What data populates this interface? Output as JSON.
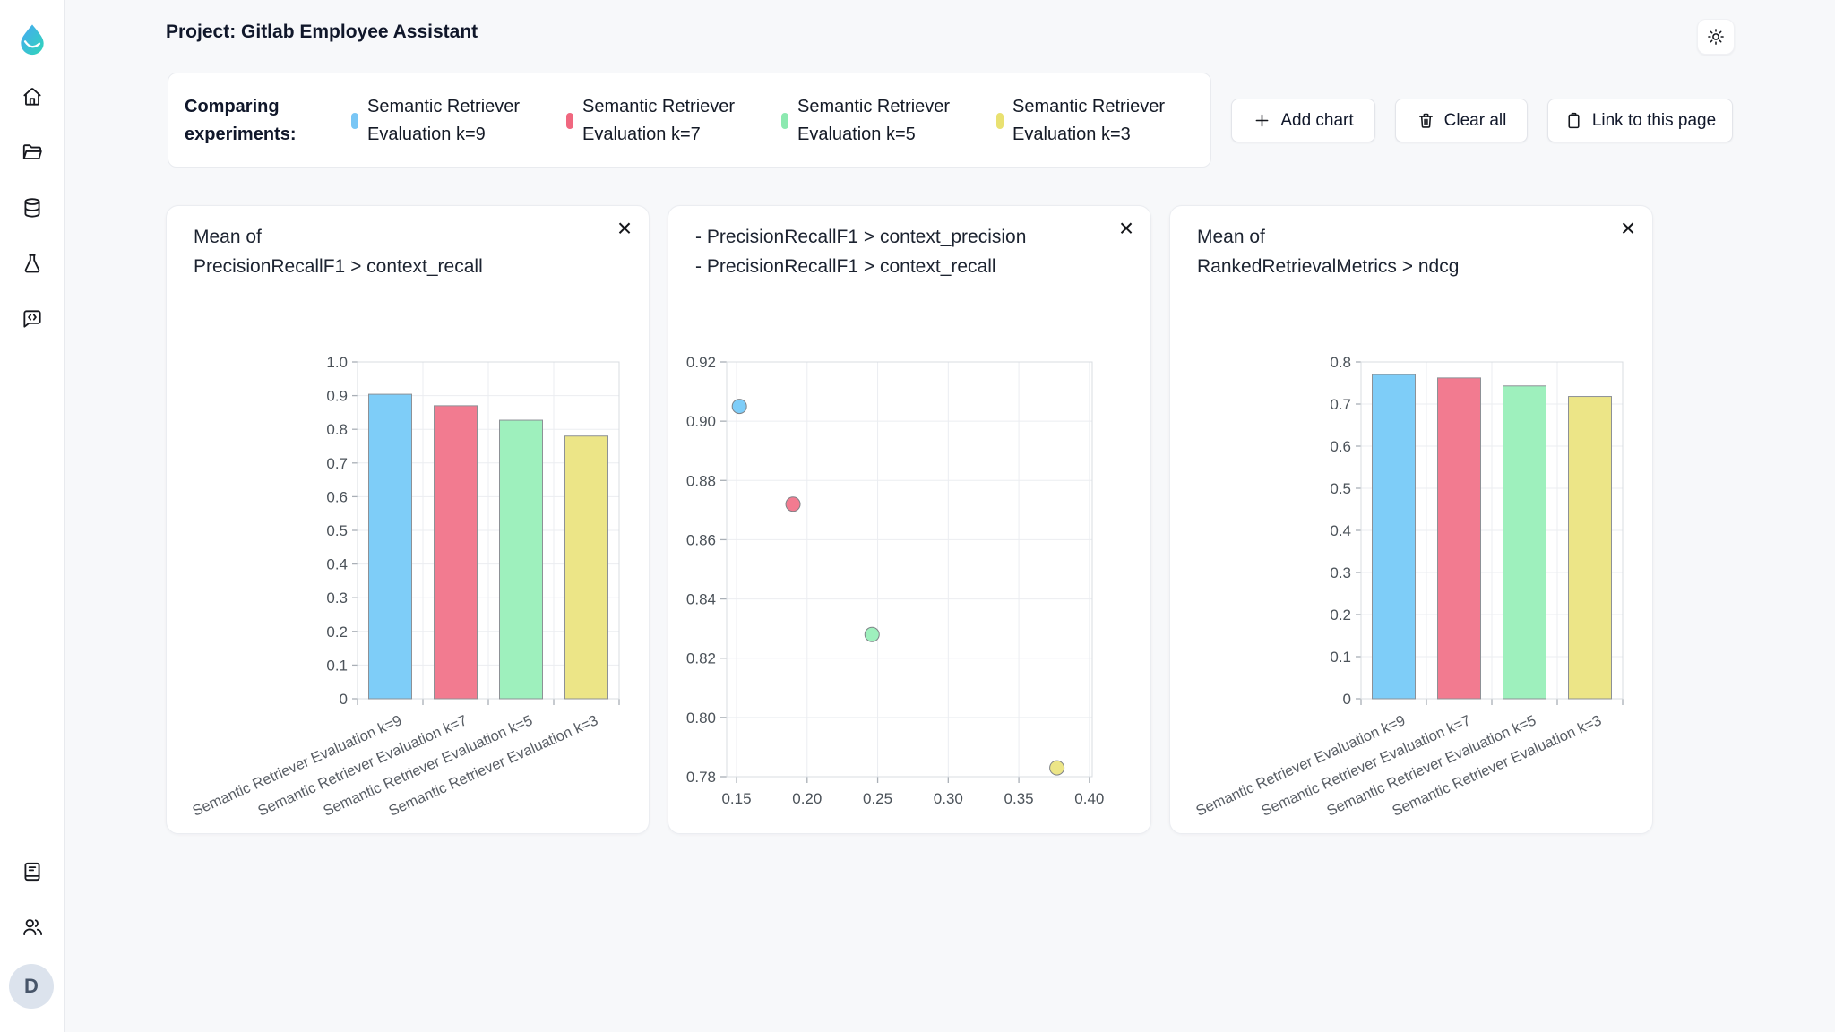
{
  "header": {
    "title": "Project: Gitlab Employee Assistant",
    "theme_toggle_icon": "sun-icon"
  },
  "sidebar": {
    "logo_icon": "app-logo-droplet",
    "items": [
      "home-icon",
      "folder-icon",
      "database-icon",
      "flask-icon",
      "chat-code-icon"
    ],
    "bottom_items": [
      "book-icon",
      "users-icon"
    ],
    "avatar_initial": "D"
  },
  "compare_bar": {
    "label": "Comparing experiments:",
    "experiments": [
      {
        "name": "Semantic Retriever Evaluation k=9",
        "color": "#79c6f5"
      },
      {
        "name": "Semantic Retriever Evaluation k=7",
        "color": "#f0677f"
      },
      {
        "name": "Semantic Retriever Evaluation k=5",
        "color": "#8ce9b0"
      },
      {
        "name": "Semantic Retriever Evaluation k=3",
        "color": "#e9e171"
      }
    ]
  },
  "actions": {
    "add_chart": "Add chart",
    "clear_all": "Clear all",
    "link_to_page": "Link to this page"
  },
  "ui": {
    "close_glyph": "×"
  },
  "chart_data": [
    {
      "type": "bar",
      "title_lines": [
        "Mean of",
        "PrecisionRecallF1 > context_recall"
      ],
      "categories": [
        "Semantic Retriever Evaluation k=9",
        "Semantic Retriever Evaluation k=7",
        "Semantic Retriever Evaluation k=5",
        "Semantic Retriever Evaluation k=3"
      ],
      "values": [
        0.904,
        0.87,
        0.827,
        0.78
      ],
      "colors": [
        "#7ecdf8",
        "#f27b90",
        "#9ef0bd",
        "#ece587"
      ],
      "ylim": [
        0,
        1.0
      ],
      "ytick_step": 0.1,
      "grid": true
    },
    {
      "type": "scatter",
      "title_lines": [
        "- PrecisionRecallF1 > context_precision",
        "- PrecisionRecallF1 > context_recall"
      ],
      "xlim": [
        0.143,
        0.402
      ],
      "xticks": [
        0.15,
        0.2,
        0.25,
        0.3,
        0.35,
        0.4
      ],
      "ylim": [
        0.78,
        0.92
      ],
      "yticks": [
        0.78,
        0.8,
        0.82,
        0.84,
        0.86,
        0.88,
        0.9,
        0.92
      ],
      "grid": true,
      "points": [
        {
          "label": "Semantic Retriever Evaluation k=9",
          "x": 0.152,
          "y": 0.905,
          "color": "#7ecdf8"
        },
        {
          "label": "Semantic Retriever Evaluation k=7",
          "x": 0.19,
          "y": 0.872,
          "color": "#f27b90"
        },
        {
          "label": "Semantic Retriever Evaluation k=5",
          "x": 0.246,
          "y": 0.828,
          "color": "#9ef0bd"
        },
        {
          "label": "Semantic Retriever Evaluation k=3",
          "x": 0.377,
          "y": 0.783,
          "color": "#ece587"
        }
      ]
    },
    {
      "type": "bar",
      "title_lines": [
        "Mean of",
        "RankedRetrievalMetrics > ndcg"
      ],
      "categories": [
        "Semantic Retriever Evaluation k=9",
        "Semantic Retriever Evaluation k=7",
        "Semantic Retriever Evaluation k=5",
        "Semantic Retriever Evaluation k=3"
      ],
      "values": [
        0.77,
        0.762,
        0.743,
        0.718
      ],
      "colors": [
        "#7ecdf8",
        "#f27b90",
        "#9ef0bd",
        "#ece587"
      ],
      "ylim": [
        0,
        0.8
      ],
      "ytick_step": 0.1,
      "grid": true
    }
  ]
}
